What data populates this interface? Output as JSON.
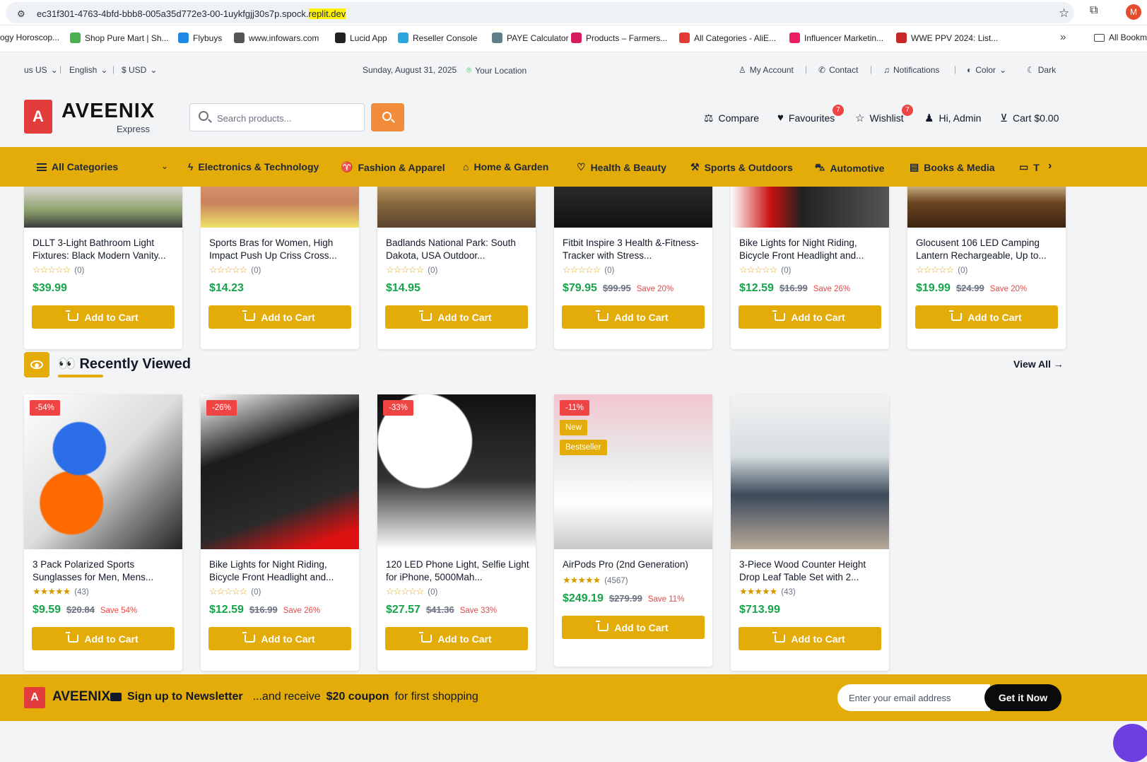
{
  "browser": {
    "url_main": "ec31f301-4763-4bfd-bbb8-005a35d772e3-00-1uykfgjj30s7p.spock.",
    "url_highlight": "replit.dev",
    "profile_initial": "M",
    "bookmarks": [
      {
        "label": "ogy Horoscop...",
        "color": "#ffffff"
      },
      {
        "label": "Shop Pure Mart | Sh...",
        "color": "#4caf50"
      },
      {
        "label": "Flybuys",
        "color": "#1e88e5"
      },
      {
        "label": "www.infowars.com",
        "color": "#555555"
      },
      {
        "label": "Lucid App",
        "color": "#222222"
      },
      {
        "label": "Reseller Console",
        "color": "#29a8e0"
      },
      {
        "label": "PAYE Calculator",
        "color": "#607d8b"
      },
      {
        "label": "Products – Farmers...",
        "color": "#d81b60"
      },
      {
        "label": "All Categories - AliE...",
        "color": "#e53935"
      },
      {
        "label": "Influencer Marketin...",
        "color": "#e91e63"
      },
      {
        "label": "WWE PPV 2024: List...",
        "color": "#c62828"
      }
    ],
    "bookmarks_folder": "All Bookm"
  },
  "topbar": {
    "country": "us US",
    "language": "English",
    "currency": "$ USD",
    "date": "Sunday, August 31, 2025",
    "location": "Your Location",
    "my_account": "My Account",
    "contact": "Contact",
    "notifications": "Notifications",
    "color": "Color",
    "dark": "Dark"
  },
  "header": {
    "logo_letter": "A",
    "brand": "AVEENIX",
    "brand_sub": "Express",
    "search_placeholder": "Search products...",
    "compare": "Compare",
    "favourites": "Favourites",
    "favourites_count": "7",
    "wishlist": "Wishlist",
    "wishlist_count": "7",
    "greeting": "Hi, Admin",
    "cart": "Cart $0.00"
  },
  "nav": {
    "all_categories": "All Categories",
    "items": [
      "Electronics & Technology",
      "Fashion & Apparel",
      "Home & Garden",
      "Health & Beauty",
      "Sports & Outdoors",
      "Automotive",
      "Books & Media",
      "T"
    ]
  },
  "top_products": [
    {
      "name": "DLLT 3-Light Bathroom Light Fixtures: Black Modern Vanity...",
      "rating": 0,
      "reviews": "(0)",
      "price": "$39.99",
      "old_price": "",
      "save": ""
    },
    {
      "name": "Sports Bras for Women, High Impact Push Up Criss Cross...",
      "rating": 0,
      "reviews": "(0)",
      "price": "$14.23",
      "old_price": "",
      "save": ""
    },
    {
      "name": "Badlands National Park: South Dakota, USA Outdoor...",
      "rating": 0,
      "reviews": "(0)",
      "price": "$14.95",
      "old_price": "",
      "save": ""
    },
    {
      "name": "Fitbit Inspire 3 Health &-Fitness-Tracker with Stress...",
      "rating": 0,
      "reviews": "(0)",
      "price": "$79.95",
      "old_price": "$99.95",
      "save": "Save 20%"
    },
    {
      "name": "Bike Lights for Night Riding, Bicycle Front Headlight and...",
      "rating": 0,
      "reviews": "(0)",
      "price": "$12.59",
      "old_price": "$16.99",
      "save": "Save 26%"
    },
    {
      "name": "Glocusent 106 LED Camping Lantern Rechargeable, Up to...",
      "rating": 0,
      "reviews": "(0)",
      "price": "$19.99",
      "old_price": "$24.99",
      "save": "Save 20%"
    }
  ],
  "recently_viewed": {
    "emoji": "👀",
    "title": "Recently Viewed",
    "view_all": "View All →",
    "products": [
      {
        "name": "3 Pack Polarized Sports Sunglasses for Men, Mens...",
        "rating": 4.5,
        "reviews": "(43)",
        "price": "$9.59",
        "old_price": "$20.84",
        "save": "Save 54%",
        "tags": [
          {
            "text": "-54%",
            "kind": "red"
          }
        ]
      },
      {
        "name": "Bike Lights for Night Riding, Bicycle Front Headlight and...",
        "rating": 0,
        "reviews": "(0)",
        "price": "$12.59",
        "old_price": "$16.99",
        "save": "Save 26%",
        "tags": [
          {
            "text": "-26%",
            "kind": "red"
          }
        ]
      },
      {
        "name": "120 LED Phone Light, Selfie Light for iPhone, 5000Mah...",
        "rating": 0,
        "reviews": "(0)",
        "price": "$27.57",
        "old_price": "$41.36",
        "save": "Save 33%",
        "tags": [
          {
            "text": "-33%",
            "kind": "red"
          }
        ]
      },
      {
        "name": "AirPods Pro (2nd Generation)",
        "rating": 4.5,
        "reviews": "(4567)",
        "price": "$249.19",
        "old_price": "$279.99",
        "save": "Save 11%",
        "tags": [
          {
            "text": "-11%",
            "kind": "red"
          },
          {
            "text": "New",
            "kind": "yel"
          },
          {
            "text": "Bestseller",
            "kind": "yel"
          }
        ]
      },
      {
        "name": "3-Piece Wood Counter Height Drop Leaf Table Set with 2...",
        "rating": 4.5,
        "reviews": "(43)",
        "price": "$713.99",
        "old_price": "",
        "save": "",
        "tags": []
      }
    ]
  },
  "add_to_cart": "Add to Cart",
  "newsletter": {
    "logo_letter": "A",
    "brand": "AVEENIX",
    "signup": "Sign up to Newsletter",
    "receive": "...and receive",
    "coupon": "$20 coupon",
    "first": "for first shopping",
    "email_placeholder": "Enter your email address",
    "button": "Get it Now"
  },
  "colors": {
    "accent": "#e4ac08",
    "brand_red": "#e23c3c",
    "price_green": "#16a34a",
    "save_red": "#ef4444"
  }
}
